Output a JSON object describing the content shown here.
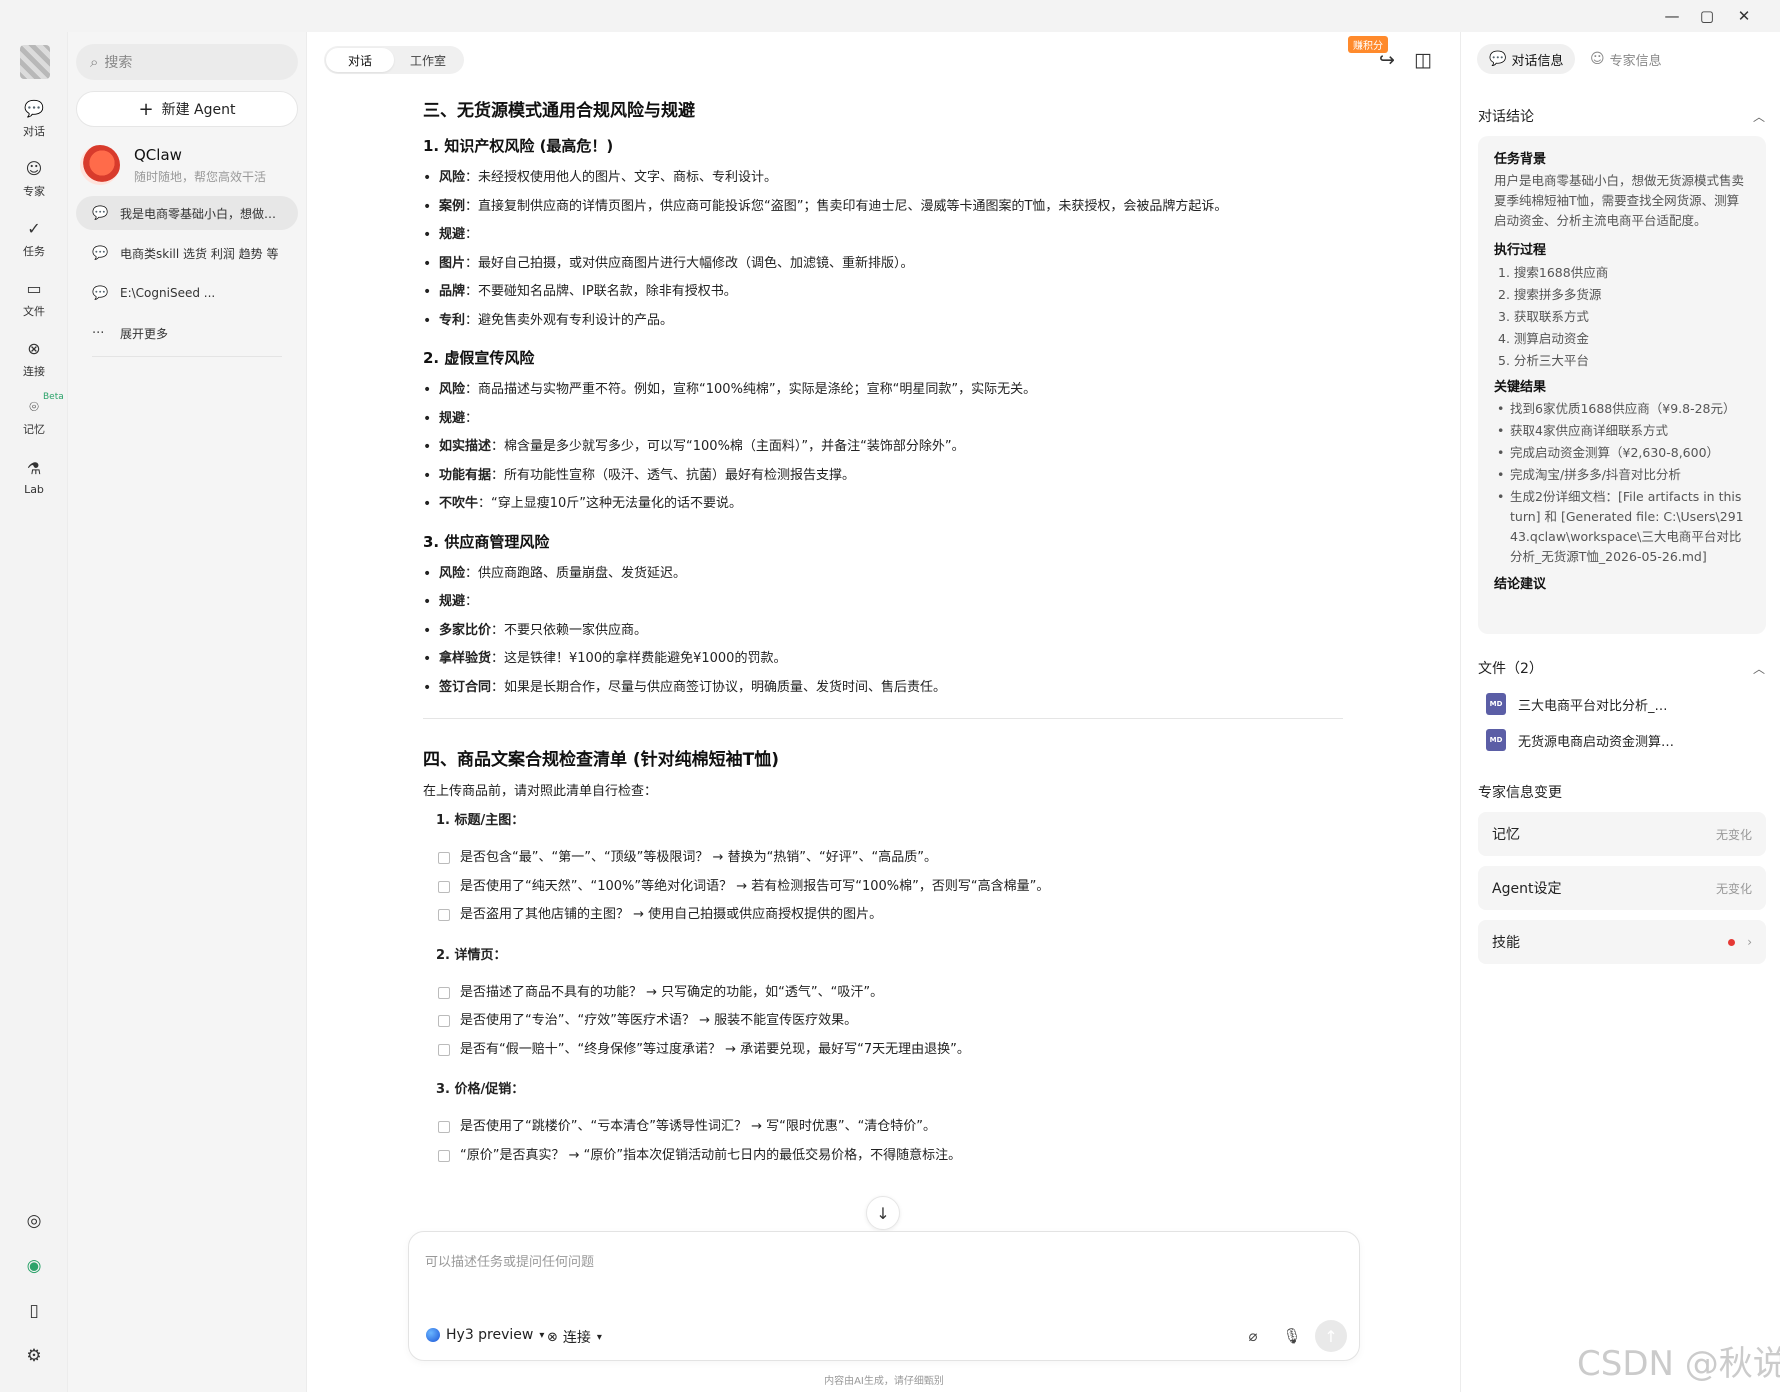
{
  "titlebar": {
    "min": "—",
    "max": "▢",
    "close": "✕"
  },
  "rail": {
    "items": [
      {
        "label": "对话",
        "icon": "chat-bubble-icon"
      },
      {
        "label": "专家",
        "icon": "expert-face-icon"
      },
      {
        "label": "任务",
        "icon": "task-check-icon"
      },
      {
        "label": "文件",
        "icon": "folder-icon"
      },
      {
        "label": "连接",
        "icon": "link-icon"
      },
      {
        "label": "记忆",
        "icon": "memory-icon"
      },
      {
        "label": "Lab",
        "icon": "flask-icon"
      }
    ],
    "beta": "Beta"
  },
  "sidebar": {
    "search_placeholder": "搜索",
    "new_agent": "新建 Agent",
    "agent": {
      "name": "QClaw",
      "subtitle": "随时随地，帮您高效干活"
    },
    "conversations": [
      "我是电商零基础小白，想做…",
      "电商类skill 选货 利润 趋势 等",
      "E:\\CogniSeed ..."
    ],
    "more": "展开更多"
  },
  "main": {
    "tabs": [
      "对话",
      "工作室"
    ],
    "earn_badge": "赚积分",
    "sections": {
      "s3_title": "三、无货源模式通用合规风险与规避",
      "s3_1_title": "1. 知识产权风险 (最高危！)",
      "s3_1": [
        {
          "k": "风险",
          "v": "：未经授权使用他人的图片、文字、商标、专利设计。"
        },
        {
          "k": "案例",
          "v": "：直接复制供应商的详情页图片，供应商可能投诉您“盗图”；售卖印有迪士尼、漫威等卡通图案的T恤，未获授权，会被品牌方起诉。"
        },
        {
          "k": "规避",
          "v": "："
        },
        {
          "k": "图片",
          "v": "：最好自己拍摄，或对供应商图片进行大幅修改（调色、加滤镜、重新排版）。"
        },
        {
          "k": "品牌",
          "v": "：不要碰知名品牌、IP联名款，除非有授权书。"
        },
        {
          "k": "专利",
          "v": "：避免售卖外观有专利设计的产品。"
        }
      ],
      "s3_2_title": "2. 虚假宣传风险",
      "s3_2": [
        {
          "k": "风险",
          "v": "：商品描述与实物严重不符。例如，宣称“100%纯棉”，实际是涤纶；宣称“明星同款”，实际无关。"
        },
        {
          "k": "规避",
          "v": "："
        },
        {
          "k": "如实描述",
          "v": "：棉含量是多少就写多少，可以写“100%棉（主面料）”，并备注“装饰部分除外”。"
        },
        {
          "k": "功能有据",
          "v": "：所有功能性宣称（吸汗、透气、抗菌）最好有检测报告支撑。"
        },
        {
          "k": "不吹牛",
          "v": "：“穿上显瘦10斤”这种无法量化的话不要说。"
        }
      ],
      "s3_3_title": "3. 供应商管理风险",
      "s3_3": [
        {
          "k": "风险",
          "v": "：供应商跑路、质量崩盘、发货延迟。"
        },
        {
          "k": "规避",
          "v": "："
        },
        {
          "k": "多家比价",
          "v": "：不要只依赖一家供应商。"
        },
        {
          "k": "拿样验货",
          "v": "：这是铁律！¥100的拿样费能避免¥1000的罚款。"
        },
        {
          "k": "签订合同",
          "v": "：如果是长期合作，尽量与供应商签订协议，明确质量、发货时间、售后责任。"
        }
      ],
      "s4_title": "四、商品文案合规检查清单 (针对纯棉短袖T恤)",
      "s4_intro": "在上传商品前，请对照此清单自行检查：",
      "checklists": [
        {
          "title": "1. 标题/主图：",
          "items": [
            "是否包含“最”、“第一”、“顶级”等极限词？ → 替换为“热销”、“好评”、“高品质”。",
            "是否使用了“纯天然”、“100%”等绝对化词语？ → 若有检测报告可写“100%棉”，否则写“高含棉量”。",
            "是否盗用了其他店铺的主图？ → 使用自己拍摄或供应商授权提供的图片。"
          ]
        },
        {
          "title": "2. 详情页：",
          "items": [
            "是否描述了商品不具有的功能？ → 只写确定的功能，如“透气”、“吸汗”。",
            "是否使用了“专治”、“疗效”等医疗术语？ → 服装不能宣传医疗效果。",
            "是否有“假一赔十”、“终身保修”等过度承诺？ → 承诺要兑现，最好写“7天无理由退换”。"
          ]
        },
        {
          "title": "3. 价格/促销：",
          "items": [
            "是否使用了“跳楼价”、“亏本清仓”等诱导性词汇？ → 写“限时优惠”、“清仓特价”。",
            "“原价”是否真实？ → “原价”指本次促销活动前七日内的最低交易价格，不得随意标注。"
          ]
        }
      ]
    },
    "composer": {
      "placeholder": "可以描述任务或提问任何问题",
      "model": "Hy3 preview",
      "connect": "连接"
    },
    "ai_note": "内容由AI生成，请仔细甄别"
  },
  "right_panel": {
    "tabs": [
      "对话信息",
      "专家信息"
    ],
    "conclusion_title": "对话结论",
    "background_title": "任务背景",
    "background": "用户是电商零基础小白，想做无货源模式售卖夏季纯棉短袖T恤，需要查找全网货源、测算启动资金、分析主流电商平台适配度。",
    "process_title": "执行过程",
    "process": [
      "1. 搜索1688供应商",
      "2. 搜索拼多多货源",
      "3. 获取联系方式",
      "4. 测算启动资金",
      "5. 分析三大平台"
    ],
    "results_title": "关键结果",
    "results": [
      "找到6家优质1688供应商（¥9.8-28元）",
      "获取4家供应商详细联系方式",
      "完成启动资金测算（¥2,630-8,600）",
      "完成淘宝/拼多多/抖音对比分析",
      "生成2份详细文档：[File artifacts in this turn] 和 [Generated file: C:\\Users\\29143.qclaw\\workspace\\三大电商平台对比分析_无货源T恤_2026-05-26.md]"
    ],
    "suggestion_title": "结论建议",
    "files_title": "文件（2）",
    "files": [
      "三大电商平台对比分析_…",
      "无货源电商启动资金测算…"
    ],
    "file_badge": "MD",
    "expert_changes_title": "专家信息变更",
    "cards": [
      {
        "label": "记忆",
        "status": "无变化"
      },
      {
        "label": "Agent设定",
        "status": "无变化"
      },
      {
        "label": "技能",
        "status": ""
      }
    ]
  },
  "watermark": "CSDN @秋说"
}
